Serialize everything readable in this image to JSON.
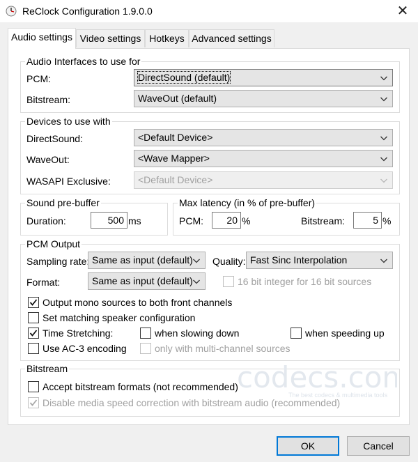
{
  "window": {
    "title": "ReClock Configuration 1.9.0.0"
  },
  "tabs": [
    "Audio settings",
    "Video settings",
    "Hotkeys",
    "Advanced settings"
  ],
  "audio_interfaces": {
    "title": "Audio Interfaces to use for",
    "pcm_label": "PCM:",
    "pcm_value": "DirectSound (default)",
    "bitstream_label": "Bitstream:",
    "bitstream_value": "WaveOut (default)"
  },
  "devices": {
    "title": "Devices to use with",
    "directsound_label": "DirectSound:",
    "directsound_value": "<Default Device>",
    "waveout_label": "WaveOut:",
    "waveout_value": "<Wave Mapper>",
    "wasapi_label": "WASAPI Exclusive:",
    "wasapi_value": "<Default Device>"
  },
  "prebuffer": {
    "title": "Sound pre-buffer",
    "duration_label": "Duration:",
    "duration_value": "500",
    "duration_unit": "ms"
  },
  "latency": {
    "title": "Max latency (in % of pre-buffer)",
    "pcm_label": "PCM:",
    "pcm_value": "20",
    "pcm_unit": "%",
    "bitstream_label": "Bitstream:",
    "bitstream_value": "5",
    "bitstream_unit": "%"
  },
  "pcm_output": {
    "title": "PCM Output",
    "sampling_label": "Sampling rate:",
    "sampling_value": "Same as input (default)",
    "quality_label": "Quality:",
    "quality_value": "Fast Sinc Interpolation",
    "format_label": "Format:",
    "format_value": "Same as input (default)",
    "opt_16bit": "16 bit integer for 16 bit sources",
    "opt_mono": "Output mono sources to both front channels",
    "opt_speaker": "Set matching speaker configuration",
    "opt_stretch": "Time Stretching:",
    "opt_slow": "when slowing down",
    "opt_speed": "when speeding up",
    "opt_ac3": "Use AC-3 encoding",
    "opt_multich": "only with multi-channel sources"
  },
  "bitstream": {
    "title": "Bitstream",
    "opt_accept": "Accept bitstream formats (not recommended)",
    "opt_disable": "Disable media speed correction with bitstream audio (recommended)"
  },
  "checks": {
    "mono": true,
    "speaker": false,
    "stretch": true,
    "slow": false,
    "speed": false,
    "ac3": false,
    "multich": false,
    "bit16": false,
    "accept": false,
    "disable": true
  },
  "watermark": {
    "text": "codecs.com",
    "sub": "The best codecs & multimedia tools"
  },
  "buttons": {
    "ok": "OK",
    "cancel": "Cancel"
  }
}
